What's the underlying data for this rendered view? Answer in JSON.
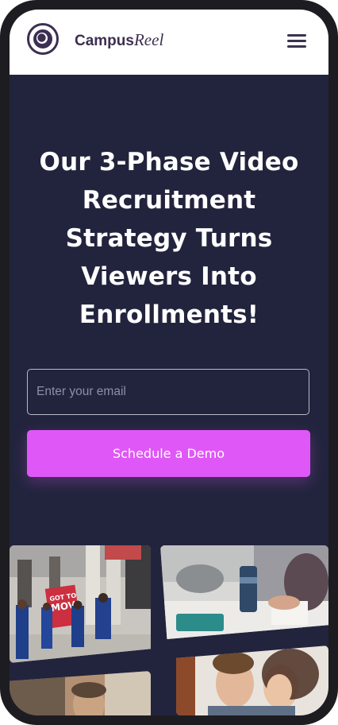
{
  "header": {
    "brand_primary": "Campus",
    "brand_secondary": "Reel",
    "logo_icon": "eye-icon",
    "menu_icon": "hamburger-menu-icon"
  },
  "hero": {
    "title": "Our 3-Phase Video Recruitment Strategy Turns Viewers Into Enrollments!"
  },
  "form": {
    "email_placeholder": "Enter your email",
    "submit_label": "Schedule a Demo"
  },
  "gallery": {
    "photo_1_sign_text": "GOT TO MOVE"
  },
  "colors": {
    "background": "#22243d",
    "accent": "#e057f7",
    "brand_text": "#3c2f52"
  }
}
